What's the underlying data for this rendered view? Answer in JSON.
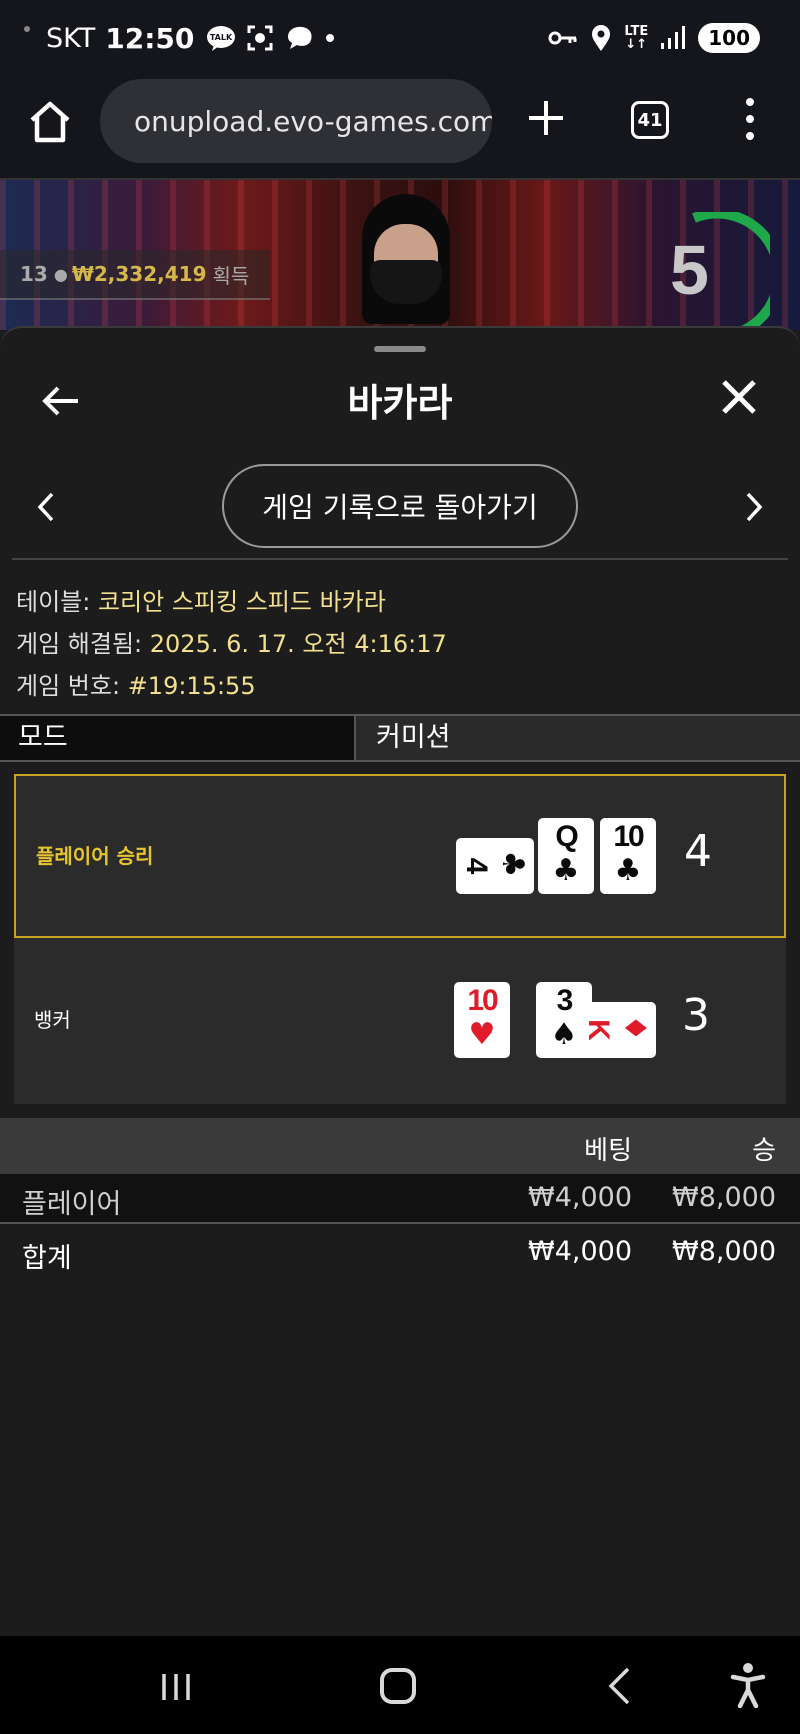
{
  "status_bar": {
    "carrier": "SKT",
    "time": "12:50",
    "talk_badge": "TALK",
    "lte_top": "LTE",
    "lte_bottom": "↓↑",
    "battery": "100"
  },
  "browser": {
    "url": "onupload.evo-games.com",
    "tab_count": "41"
  },
  "video": {
    "winners_count": "13",
    "winners_amount": "₩2,332,419",
    "winners_label": "획득",
    "timer": "5",
    "timer_color": "#1fa84a"
  },
  "panel": {
    "title": "바카라",
    "back_to_history": "게임 기록으로 돌아가기",
    "info": {
      "table_label": "테이블:",
      "table_value": "코리안 스피킹 스피드 바카라",
      "resolved_label": "게임 해결됨:",
      "resolved_value": "2025. 6. 17. 오전 4:16:17",
      "number_label": "게임 번호:",
      "number_value": "#19:15:55"
    },
    "tabs": [
      "모드",
      "커미션"
    ],
    "results": [
      {
        "label": "플레이어 승리",
        "winner": true,
        "score": "4",
        "cards": [
          {
            "rank": "4",
            "suit": "♣",
            "color": "black",
            "sideways": true
          },
          {
            "rank": "Q",
            "suit": "♣",
            "color": "black",
            "sideways": false
          },
          {
            "rank": "10",
            "suit": "♣",
            "color": "black",
            "sideways": false
          }
        ]
      },
      {
        "label": "뱅커",
        "winner": false,
        "score": "3",
        "cards": [
          {
            "rank": "10",
            "suit": "♥",
            "color": "red",
            "sideways": false
          },
          {
            "rank": "3",
            "suit": "♠",
            "color": "black",
            "sideways": false
          },
          {
            "rank": "K",
            "suit": "♦",
            "color": "red",
            "sideways": true
          }
        ]
      }
    ],
    "bets": {
      "col_bet": "베팅",
      "col_win": "승",
      "rows": [
        {
          "name": "플레이어",
          "bet": "₩4,000",
          "win": "₩8,000"
        }
      ],
      "total": {
        "name": "합계",
        "bet": "₩4,000",
        "win": "₩8,000"
      }
    }
  },
  "colors": {
    "winner_accent": "#c9a21f",
    "info_value": "#f3e08e",
    "red_suit": "#e01b2a"
  }
}
